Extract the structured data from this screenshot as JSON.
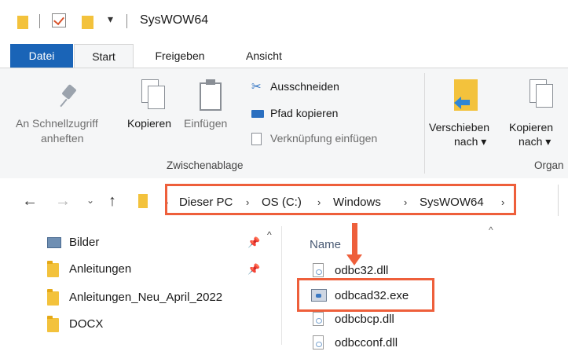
{
  "window": {
    "title": "SysWOW64"
  },
  "ribbon_tabs": [
    "Datei",
    "Start",
    "Freigeben",
    "Ansicht"
  ],
  "clipboard_group": {
    "pin_label_line1": "An Schnellzugriff",
    "pin_label_line2": "anheften",
    "copy_label": "Kopieren",
    "paste_label": "Einfügen",
    "cut_label": "Ausschneiden",
    "copy_path_label": "Pfad kopieren",
    "paste_shortcut_label": "Verknüpfung einfügen",
    "group_label": "Zwischenablage"
  },
  "organize_group": {
    "move_label_line1": "Verschieben",
    "move_label_line2": "nach ▾",
    "copyto_label_line1": "Kopieren",
    "copyto_label_line2": "nach ▾",
    "group_label": "Organ"
  },
  "breadcrumb": [
    "Dieser PC",
    "OS (C:)",
    "Windows",
    "SysWOW64"
  ],
  "nav_pane": {
    "items": [
      {
        "label": "Bilder",
        "pinned": true
      },
      {
        "label": "Anleitungen",
        "pinned": true
      },
      {
        "label": "Anleitungen_Neu_April_2022",
        "pinned": false
      },
      {
        "label": "DOCX",
        "pinned": false
      }
    ]
  },
  "file_list": {
    "column_name": "Name",
    "files": [
      "odbc32.dll",
      "odbcad32.exe",
      "odbcbcp.dll",
      "odbcconf.dll"
    ]
  },
  "colors": {
    "accent": "#1a64b7",
    "highlight": "#ee5f3b",
    "folder": "#f3c23c"
  }
}
